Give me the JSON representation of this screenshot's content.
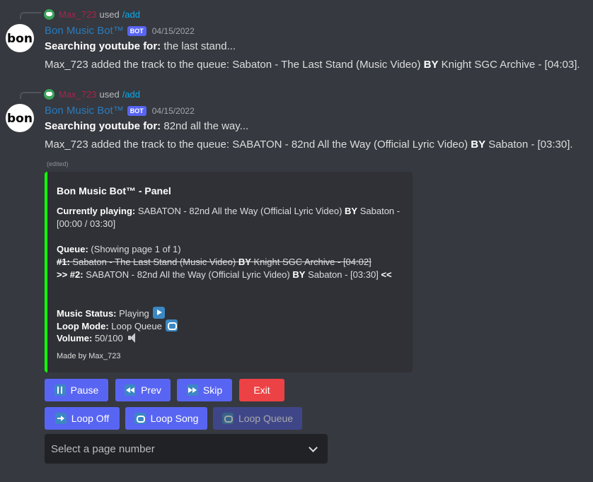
{
  "messages": [
    {
      "reply": {
        "user": "Max_723",
        "used": "used",
        "command": "/add"
      },
      "author": "Bon Music Bot™",
      "badge": "BOT",
      "timestamp": "04/15/2022",
      "search_label": "Searching youtube for:",
      "search_query": "the last stand...",
      "added_prefix": "Max_723 added the track to the queue: Sabaton - The Last Stand (Music Video)",
      "by": "BY",
      "added_suffix": "Knight SGC Archive - [04:03]."
    },
    {
      "reply": {
        "user": "Max_723",
        "used": "used",
        "command": "/add"
      },
      "author": "Bon Music Bot™",
      "badge": "BOT",
      "timestamp": "04/15/2022",
      "search_label": "Searching youtube for:",
      "search_query": "82nd all the way...",
      "added_prefix": "Max_723 added the track to the queue: SABATON - 82nd All the Way (Official Lyric Video)",
      "by": "BY",
      "added_suffix": "Sabaton - [03:30]."
    }
  ],
  "avatar_text": "bon",
  "edited": "(edited)",
  "panel": {
    "accent": "#0fff00",
    "title": "Bon Music Bot™ - Panel",
    "playing_label": "Currently playing:",
    "playing_track": "SABATON - 82nd All the Way (Official Lyric Video)",
    "playing_by": "BY",
    "playing_artist": "Sabaton -",
    "playing_time": "[00:00 / 03:30]",
    "queue_label": "Queue:",
    "queue_page": "(Showing page 1 of 1)",
    "q1_num": "#1:",
    "q1_track": "Sabaton - The Last Stand (Music Video)",
    "q1_by": "BY",
    "q1_rest": "Knight SGC Archive - [04:02]",
    "q2_num": ">> #2:",
    "q2_track": "SABATON - 82nd All the Way (Official Lyric Video)",
    "q2_by": "BY",
    "q2_rest": "Sabaton - [03:30]",
    "q2_end": "<<",
    "status_label": "Music Status:",
    "status_value": "Playing",
    "loop_label": "Loop Mode:",
    "loop_value": "Loop Queue",
    "volume_label": "Volume:",
    "volume_value": "50/100",
    "footer": "Made by Max_723"
  },
  "buttons": {
    "pause": "Pause",
    "prev": "Prev",
    "skip": "Skip",
    "exit": "Exit",
    "loop_off": "Loop Off",
    "loop_song": "Loop Song",
    "loop_queue": "Loop Queue"
  },
  "select": {
    "placeholder": "Select a page number"
  },
  "colors": {
    "blurple": "#5865f2",
    "danger": "#ed4245",
    "background": "#36393f",
    "embed": "#2f3136"
  }
}
